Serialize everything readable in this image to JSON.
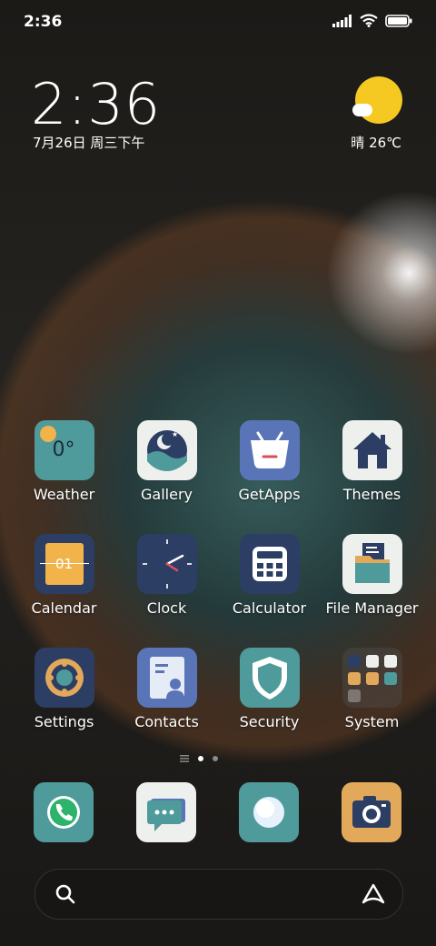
{
  "status_bar": {
    "time": "2:36",
    "icons": [
      "signal-icon",
      "wifi-icon",
      "battery-icon"
    ]
  },
  "clock_widget": {
    "time": "2:36",
    "date": "7月26日 周三下午"
  },
  "weather_widget": {
    "condition": "晴",
    "temperature": "26℃",
    "icon": "sun-icon"
  },
  "apps": [
    {
      "label": "Weather",
      "icon": "weather-icon",
      "badge_text": "0°"
    },
    {
      "label": "Gallery",
      "icon": "gallery-icon"
    },
    {
      "label": "GetApps",
      "icon": "getapps-icon"
    },
    {
      "label": "Themes",
      "icon": "themes-icon"
    },
    {
      "label": "Calendar",
      "icon": "calendar-icon",
      "badge_text": "01"
    },
    {
      "label": "Clock",
      "icon": "clock-icon"
    },
    {
      "label": "Calculator",
      "icon": "calculator-icon"
    },
    {
      "label": "File Manager",
      "icon": "file-manager-icon"
    },
    {
      "label": "Settings",
      "icon": "settings-icon"
    },
    {
      "label": "Contacts",
      "icon": "contacts-icon"
    },
    {
      "label": "Security",
      "icon": "security-icon"
    },
    {
      "label": "System",
      "icon": "system-folder-icon"
    }
  ],
  "page_indicator": {
    "pages": 2,
    "current": 1
  },
  "dock": [
    {
      "icon": "phone-icon"
    },
    {
      "icon": "messages-icon"
    },
    {
      "icon": "browser-icon"
    },
    {
      "icon": "camera-icon"
    }
  ],
  "search": {
    "icons": [
      "search-icon",
      "assistant-icon"
    ]
  },
  "colors": {
    "teal": "#4f9a9a",
    "navy": "#2c3e63",
    "orange": "#e3a95b",
    "sun": "#f5c922"
  }
}
